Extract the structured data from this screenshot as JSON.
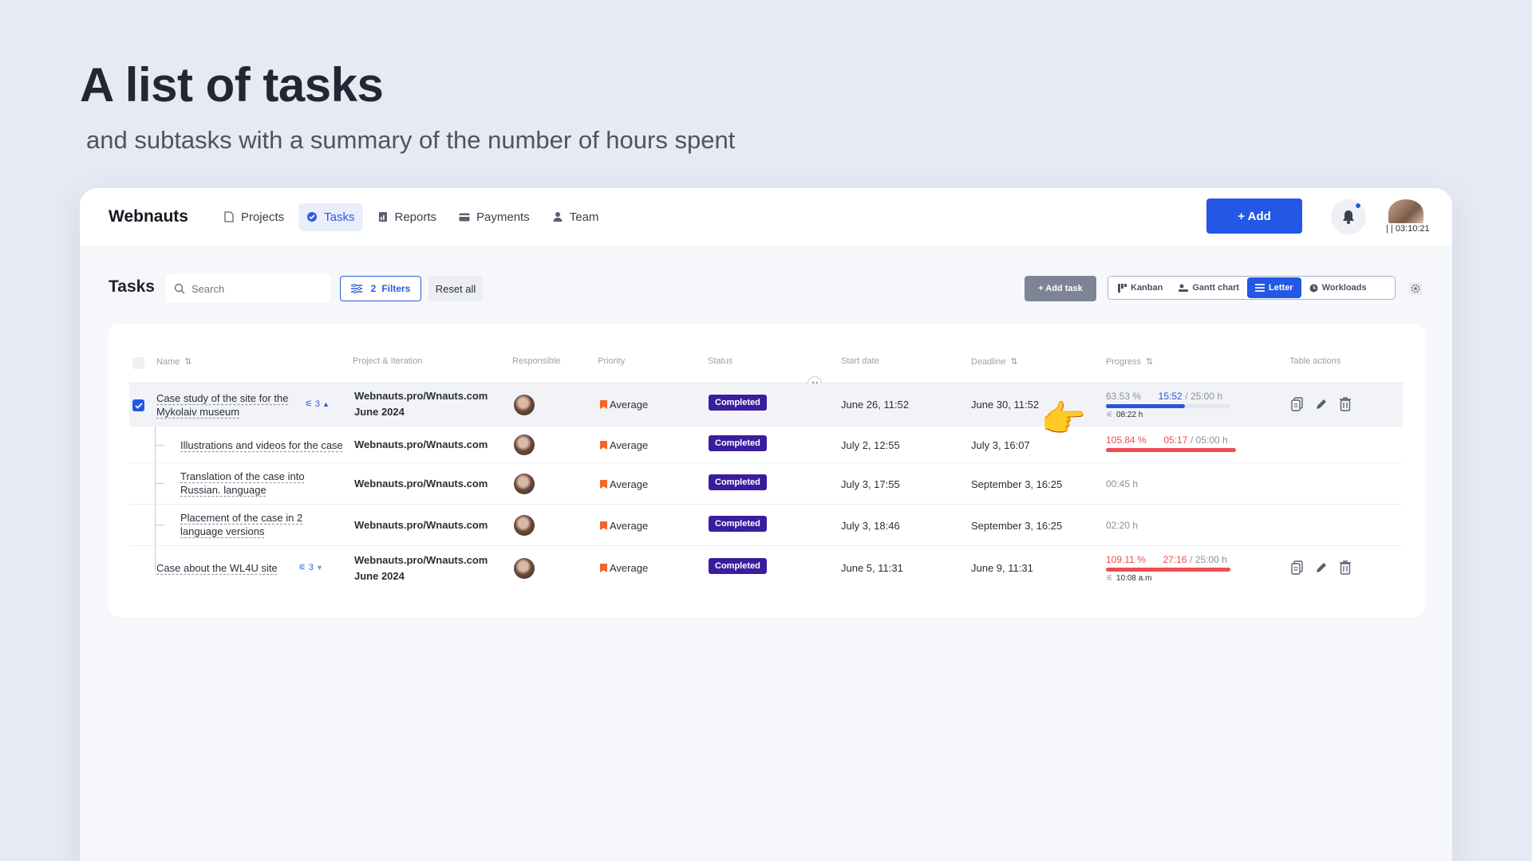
{
  "headline": "A list of tasks",
  "subline": "and subtasks with a summary of the number of hours spent",
  "app": {
    "logo": "Webnauts",
    "nav": [
      {
        "label": "Projects",
        "icon": "file-icon"
      },
      {
        "label": "Tasks",
        "icon": "check-circle-icon",
        "active": true
      },
      {
        "label": "Reports",
        "icon": "report-icon"
      },
      {
        "label": "Payments",
        "icon": "card-icon"
      },
      {
        "label": "Team",
        "icon": "user-icon"
      }
    ],
    "add_label": "+ Add",
    "timer": "| | 03:10:21"
  },
  "toolbar": {
    "title": "Tasks",
    "search_placeholder": "Search",
    "filters_count": "2",
    "filters_label": "Filters",
    "reset_label": "Reset all",
    "add_task_label": "+ Add task",
    "views": [
      {
        "label": "Kanban"
      },
      {
        "label": "Gantt chart"
      },
      {
        "label": "Letter",
        "active": true
      },
      {
        "label": "Workloads"
      }
    ]
  },
  "table": {
    "headers": {
      "name": "Name",
      "project": "Project & Iteration",
      "responsible": "Responsible",
      "priority": "Priority",
      "status": "Status",
      "start": "Start date",
      "deadline": "Deadline",
      "progress": "Progress",
      "actions": "Table actions"
    },
    "rows": [
      {
        "name_line1": "Case study of the site for the",
        "name_line2": "Mykolaiv museum",
        "subtasks": "3",
        "project": "Webnauts.pro/Wnauts.com",
        "iteration": "June 2024",
        "priority": "Average",
        "status": "Completed",
        "start": "June 26, 11:52",
        "deadline": "June 30, 11:52",
        "pct": "63.53 %",
        "spent": "15:52",
        "total": "/ 25:00 h",
        "fill": 0.6353,
        "sub_time": "08:22 h"
      },
      {
        "name_line1": "Illustrations and videos for the case",
        "project": "Webnauts.pro/Wnauts.com",
        "priority": "Average",
        "status": "Completed",
        "start": "July 2, 12:55",
        "deadline": "July 3, 16:07",
        "pct": "105.84 %",
        "spent": "05:17",
        "total": "/ 05:00 h",
        "fill": 1.0
      },
      {
        "name_line1": "Translation of the case into",
        "name_line2": "Russian. language",
        "project": "Webnauts.pro/Wnauts.com",
        "priority": "Average",
        "status": "Completed",
        "start": "July 3, 17:55",
        "deadline": "September 3, 16:25",
        "hours": "00:45 h"
      },
      {
        "name_line1": "Placement of the case in 2",
        "name_line2": "language versions",
        "project": "Webnauts.pro/Wnauts.com",
        "priority": "Average",
        "status": "Completed",
        "start": "July 3, 18:46",
        "deadline": "September 3, 16:25",
        "hours": "02:20 h"
      },
      {
        "name_line1": "Case about the WL4U site",
        "subtasks": "3",
        "project": "Webnauts.pro/Wnauts.com",
        "iteration": "June 2024",
        "priority": "Average",
        "status": "Completed",
        "start": "June 5, 11:31",
        "deadline": "June 9, 11:31",
        "pct": "109.11 %",
        "spent": "27:16",
        "total": "/ 25:00 h",
        "fill": 1.0,
        "sub_time": "10:08 a.m"
      }
    ]
  },
  "colors": {
    "accent": "#2357e6",
    "bar_blue": "#2f52d6",
    "bar_red": "#ef4d52",
    "badge": "#3a1d9e",
    "priority": "#f2662a"
  },
  "decor": {
    "pointer": "👉"
  }
}
